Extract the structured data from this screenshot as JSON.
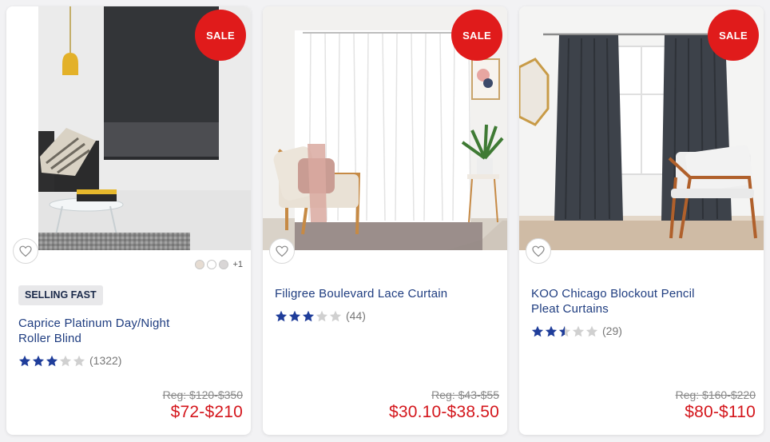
{
  "products": [
    {
      "sale_label": "SALE",
      "badge": "SELLING FAST",
      "title_line1": "Caprice Platinum Day/Night",
      "title_line2": "Roller Blind",
      "rating": 3,
      "reviews": "(1322)",
      "swatch_more": "+1",
      "swatch_colors": [
        "#e6dcd2",
        "#ffffff",
        "#d9d6d6"
      ],
      "reg_price": "Reg: $120-$350",
      "price": "$72-$210"
    },
    {
      "sale_label": "SALE",
      "title_line1": "Filigree Boulevard Lace Curtain",
      "rating": 3,
      "reviews": "(44)",
      "reg_price": "Reg: $43-$55",
      "price": "$30.10-$38.50"
    },
    {
      "sale_label": "SALE",
      "title_line1": "KOO Chicago Blockout Pencil",
      "title_line2": "Pleat Curtains",
      "rating": 2.5,
      "reviews": "(29)",
      "reg_price": "Reg: $160-$220",
      "price": "$80-$110"
    }
  ],
  "icons": {
    "heart": "heart-icon",
    "star": "star-icon"
  },
  "colors": {
    "sale": "#e01b1b",
    "title": "#1f3d80",
    "price": "#d4161c",
    "star_filled": "#1f3d9a",
    "star_empty": "#d0d0d0"
  }
}
